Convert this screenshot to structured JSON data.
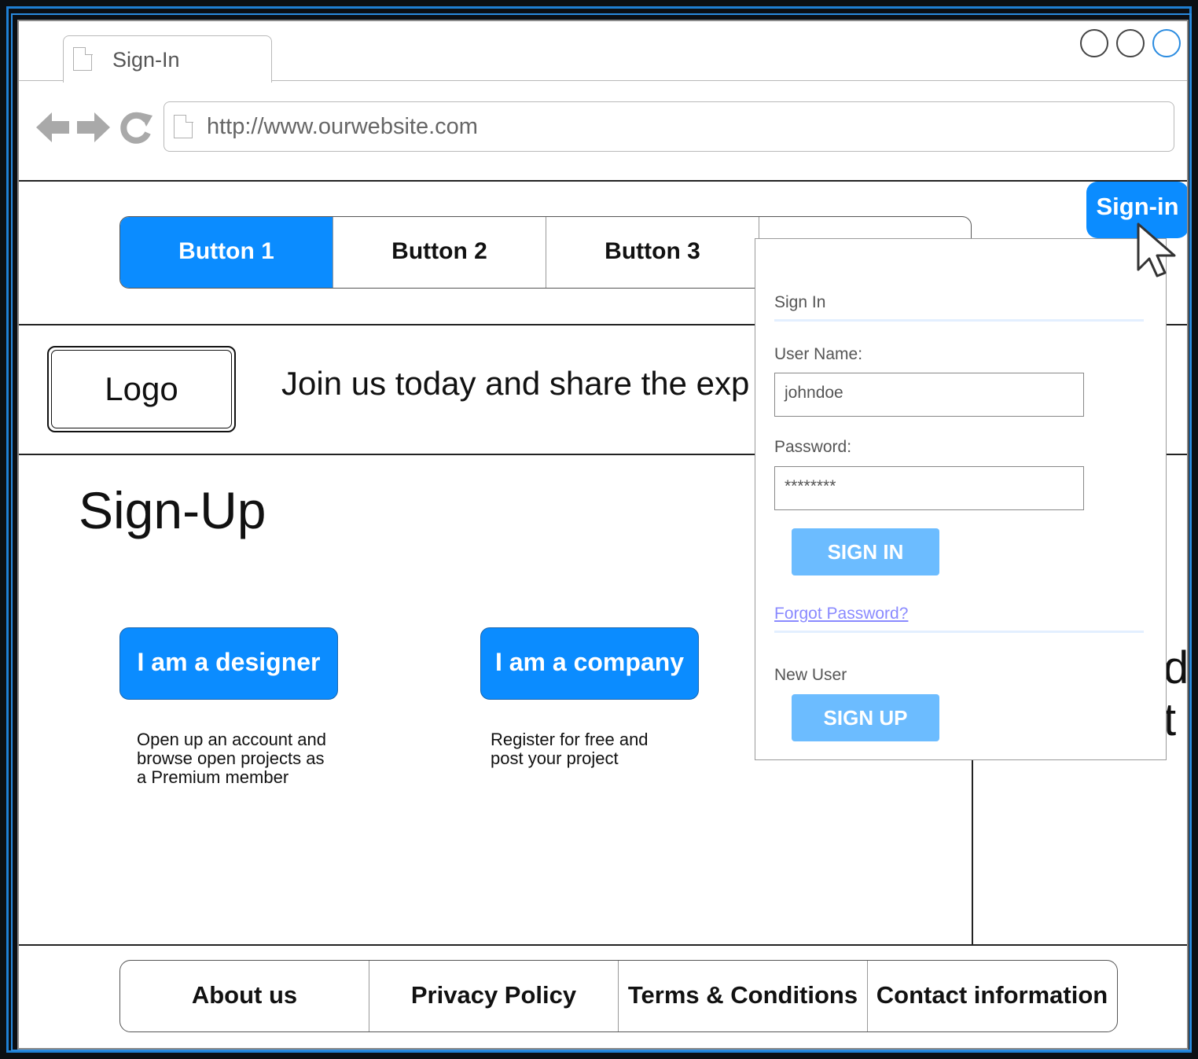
{
  "browser": {
    "tab_title": "Sign-In",
    "url": "http://www.ourwebsite.com",
    "nav_icons": [
      "back-arrow-icon",
      "forward-arrow-icon",
      "reload-icon"
    ]
  },
  "topnav": {
    "items": [
      {
        "label": "Button 1",
        "active": true
      },
      {
        "label": "Button 2",
        "active": false
      },
      {
        "label": "Button 3",
        "active": false
      },
      {
        "label": "",
        "active": false
      }
    ]
  },
  "header": {
    "logo": "Logo",
    "tagline": "Join us today and share the exp"
  },
  "main": {
    "title": "Sign-Up",
    "options": [
      {
        "button": "I am a designer",
        "lines": [
          "Open up an account and",
          "browse open projects as",
          "a Premium member"
        ]
      },
      {
        "button": "I am a company",
        "lines": [
          "Register for free and",
          "post your project"
        ]
      }
    ],
    "side_partial": [
      "d",
      "t"
    ]
  },
  "signin_button": "Sign-in",
  "signin_popup": {
    "heading": "Sign In",
    "username_label": "User Name:",
    "username_value": "johndoe",
    "password_label": "Password:",
    "password_value": "********",
    "signin_label": "SIGN IN",
    "forgot_link": "Forgot Password?",
    "new_user_label": "New User",
    "signup_label": "SIGN UP"
  },
  "footer": {
    "links": [
      "About us",
      "Privacy Policy",
      "Terms & Conditions",
      "Contact information"
    ]
  },
  "colors": {
    "accent": "#0b8cff",
    "popup_button": "#6cbcff",
    "link": "#8a8aff",
    "frame": "#1e7fd4"
  }
}
